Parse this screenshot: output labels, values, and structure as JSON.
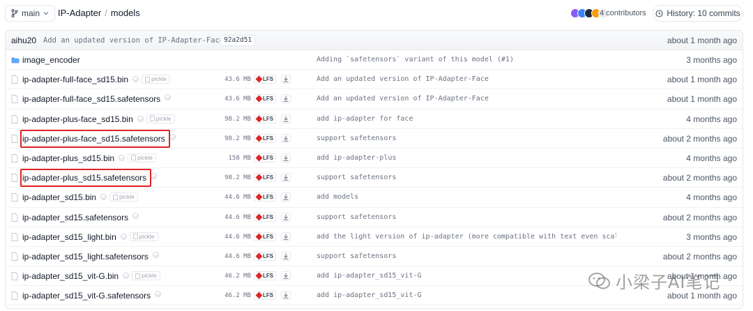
{
  "header": {
    "branch": "main",
    "repo": "IP-Adapter",
    "separator": "/",
    "folder": "models",
    "contributors": "4 contributors",
    "history": "History: 10 commits",
    "avatar_colors": [
      "#8b5cf6",
      "#3b82f6",
      "#1f2937",
      "#f59e0b",
      "#e5e7eb"
    ]
  },
  "last_commit": {
    "user": "aihu20",
    "message": "Add an updated version of IP-Adapter-Face",
    "sha": "92a2d51",
    "date": "about 1 month ago"
  },
  "files": [
    {
      "name": "image_encoder",
      "type": "folder",
      "size": "",
      "lfs": false,
      "pickle": false,
      "commit": "Adding `safetensors` variant of this model (#1)",
      "date": "3 months ago"
    },
    {
      "name": "ip-adapter-full-face_sd15.bin",
      "type": "file",
      "size": "43.6 MB",
      "lfs": true,
      "pickle": true,
      "commit": "Add an updated version of IP-Adapter-Face",
      "date": "about 1 month ago"
    },
    {
      "name": "ip-adapter-full-face_sd15.safetensors",
      "type": "file",
      "size": "43.6 MB",
      "lfs": true,
      "pickle": false,
      "commit": "Add an updated version of IP-Adapter-Face",
      "date": "about 1 month ago"
    },
    {
      "name": "ip-adapter-plus-face_sd15.bin",
      "type": "file",
      "size": "98.2 MB",
      "lfs": true,
      "pickle": true,
      "commit": "add ip-adapter for face",
      "date": "4 months ago"
    },
    {
      "name": "ip-adapter-plus-face_sd15.safetensors",
      "type": "file",
      "size": "98.2 MB",
      "lfs": true,
      "pickle": false,
      "commit": "support safetensors",
      "date": "about 2 months ago",
      "highlighted": true
    },
    {
      "name": "ip-adapter-plus_sd15.bin",
      "type": "file",
      "size": "158 MB",
      "lfs": true,
      "pickle": true,
      "commit": "add ip-adapter-plus",
      "date": "4 months ago"
    },
    {
      "name": "ip-adapter-plus_sd15.safetensors",
      "type": "file",
      "size": "98.2 MB",
      "lfs": true,
      "pickle": false,
      "commit": "support safetensors",
      "date": "about 2 months ago",
      "highlighted": true
    },
    {
      "name": "ip-adapter_sd15.bin",
      "type": "file",
      "size": "44.6 MB",
      "lfs": true,
      "pickle": true,
      "commit": "add models",
      "date": "4 months ago"
    },
    {
      "name": "ip-adapter_sd15.safetensors",
      "type": "file",
      "size": "44.6 MB",
      "lfs": true,
      "pickle": false,
      "commit": "support safetensors",
      "date": "about 2 months ago"
    },
    {
      "name": "ip-adapter_sd15_light.bin",
      "type": "file",
      "size": "44.6 MB",
      "lfs": true,
      "pickle": true,
      "commit": "add the light version of ip-adapter (more compatible with text even scale",
      "date": "3 months ago"
    },
    {
      "name": "ip-adapter_sd15_light.safetensors",
      "type": "file",
      "size": "44.6 MB",
      "lfs": true,
      "pickle": false,
      "commit": "support safetensors",
      "date": "about 2 months ago"
    },
    {
      "name": "ip-adapter_sd15_vit-G.bin",
      "type": "file",
      "size": "46.2 MB",
      "lfs": true,
      "pickle": true,
      "commit": "add ip-adapter_sd15_vit-G",
      "date": "about 1 month ago"
    },
    {
      "name": "ip-adapter_sd15_vit-G.safetensors",
      "type": "file",
      "size": "46.2 MB",
      "lfs": true,
      "pickle": false,
      "commit": "add ip-adapter_sd15_vit-G",
      "date": "about 1 month ago"
    }
  ],
  "labels": {
    "lfs": "LFS",
    "pickle": "pickle"
  },
  "watermark": "小梁子AI笔记"
}
